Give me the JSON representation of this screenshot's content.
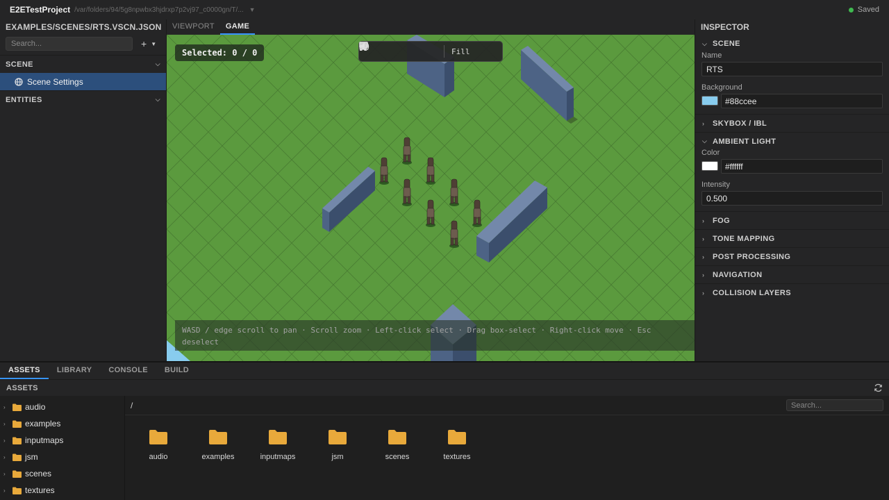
{
  "titlebar": {
    "project": "E2ETestProject",
    "path": "/var/folders/94/5g8npwbx3hjdrxp7p2vj97_c0000gn/T/...",
    "status": "Saved",
    "status_color": "#3fb950"
  },
  "left_panel": {
    "title": "EXAMPLES/SCENES/RTS.VSCN.JSON",
    "search_placeholder": "Search...",
    "add_icon": "plus-icon",
    "sections": {
      "scene": "SCENE",
      "entities": "ENTITIES"
    },
    "scene_item": "Scene Settings"
  },
  "viewport": {
    "tabs": [
      "VIEWPORT",
      "GAME"
    ],
    "active_tab": "GAME",
    "selected_text": "Selected: 0 / 0",
    "fill_label": "Fill",
    "hint_line1": "WASD / edge scroll to pan · Scroll zoom · Left-click select · Drag box-select · Right-click move · Esc",
    "hint_line2": "deselect",
    "ground_color": "#5b9a3e",
    "wall_color": "#5a7294"
  },
  "inspector": {
    "title": "INSPECTOR",
    "scene_section": "SCENE",
    "name_label": "Name",
    "name_value": "RTS",
    "background_label": "Background",
    "background_value": "#88ccee",
    "background_swatch": "#88ccee",
    "collapsed_a": "SKYBOX / IBL",
    "ambient_section": "AMBIENT LIGHT",
    "color_label": "Color",
    "color_value": "#ffffff",
    "color_swatch": "#ffffff",
    "intensity_label": "Intensity",
    "intensity_value": "0.500",
    "collapsed": [
      "FOG",
      "TONE MAPPING",
      "POST PROCESSING",
      "NAVIGATION",
      "COLLISION LAYERS"
    ]
  },
  "bottom": {
    "tabs": [
      "ASSETS",
      "LIBRARY",
      "CONSOLE",
      "BUILD"
    ],
    "active_tab": "ASSETS",
    "header": "ASSETS",
    "refresh_icon": "refresh-icon",
    "tree": [
      "audio",
      "examples",
      "inputmaps",
      "jsm",
      "scenes",
      "textures"
    ],
    "breadcrumb": "/",
    "search_placeholder": "Search...",
    "folders": [
      "audio",
      "examples",
      "inputmaps",
      "jsm",
      "scenes",
      "textures"
    ],
    "folder_color": "#e8a93b"
  }
}
